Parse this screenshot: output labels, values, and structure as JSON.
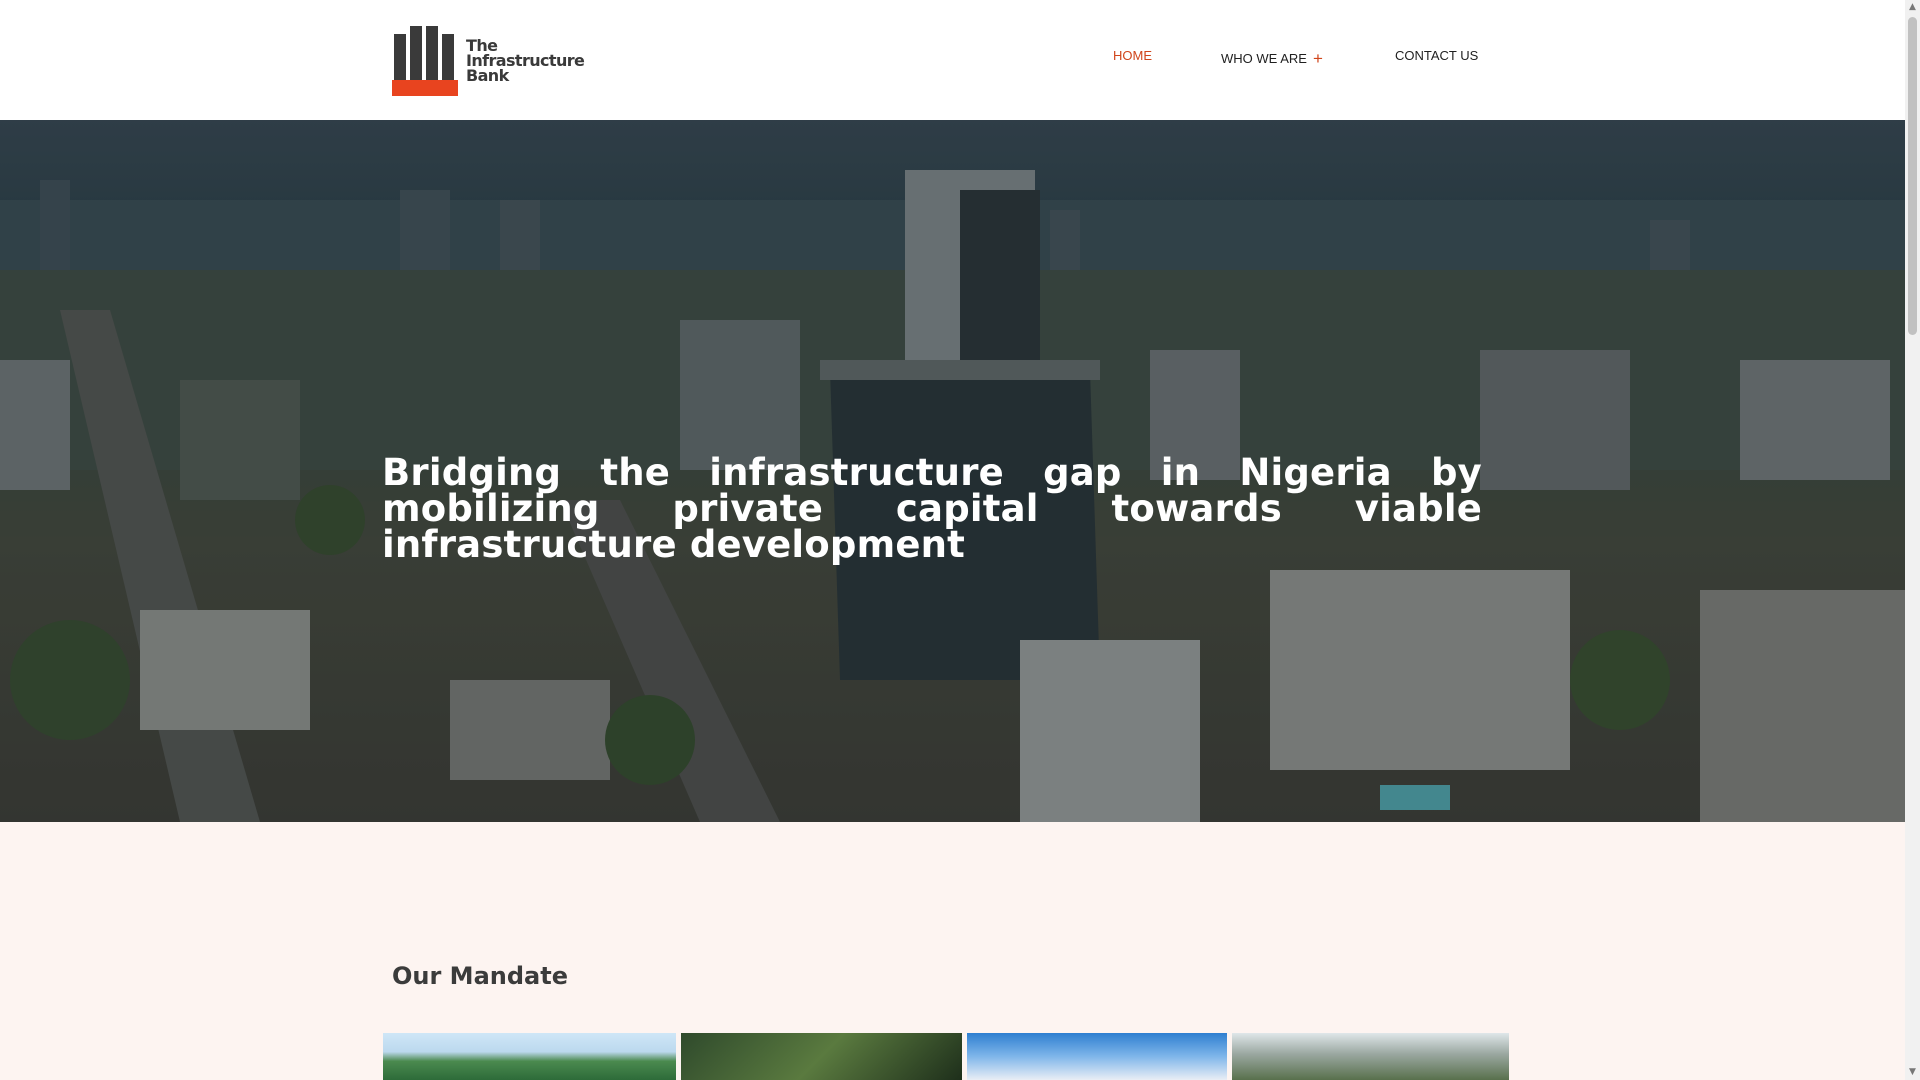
{
  "brand": {
    "logo_lines": [
      "The",
      "Infrastructure",
      "Bank"
    ],
    "accent_color": "#e8441f",
    "dark_color": "#3a3a3a"
  },
  "nav": {
    "items": [
      {
        "label": "HOME",
        "active": true
      },
      {
        "label": "WHO WE ARE",
        "has_submenu": true,
        "submenu_icon": "plus-icon"
      },
      {
        "label": "CONTACT US"
      }
    ],
    "active_color": "#d0451b"
  },
  "hero": {
    "headline": "Bridging the infrastructure gap in Nigeria by mobilizing private capital towards viable infrastructure development"
  },
  "mandate": {
    "title": "Our Mandate",
    "background": "#fdf4f1"
  }
}
